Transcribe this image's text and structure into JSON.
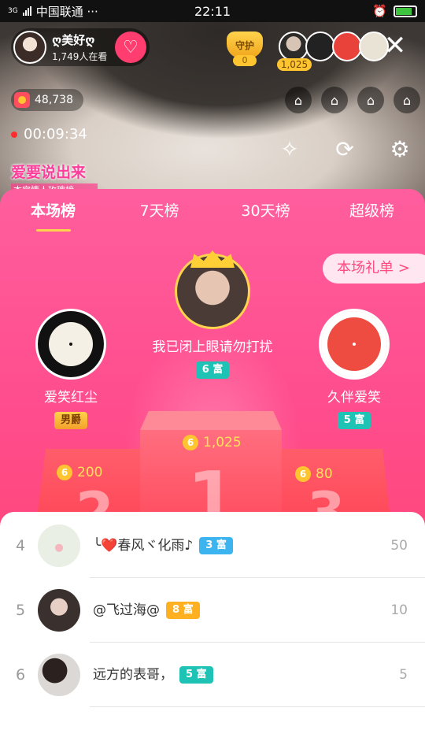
{
  "statusbar": {
    "network": "3G",
    "carrier": "中国联通 ···",
    "time": "22:11"
  },
  "host": {
    "name": "ღ美好ღ",
    "viewers": "1,749人在看"
  },
  "guard": {
    "label": "守护",
    "count": "0"
  },
  "top_viewer_badge": "1,025",
  "coins": {
    "value": "48,738"
  },
  "timer": "00:09:34",
  "banner": {
    "title": "爱要说出来",
    "subtitle": "本宫情人玫瑰榜"
  },
  "tabs": [
    {
      "label": "本场榜",
      "active": true
    },
    {
      "label": "7天榜",
      "active": false
    },
    {
      "label": "30天榜",
      "active": false
    },
    {
      "label": "超级榜",
      "active": false
    }
  ],
  "gift_list_button": "本场礼单 >",
  "podium": {
    "first": {
      "name": "我已闭上眼请勿打扰",
      "badge": "6 富",
      "score": "1,025"
    },
    "second": {
      "name": "爱笑红尘",
      "badge": "男爵",
      "score": "200",
      "place": "2"
    },
    "third": {
      "name": "久伴爱笑",
      "badge": "5 富",
      "score": "80",
      "place": "3"
    },
    "first_place": "1"
  },
  "list": [
    {
      "rank": "4",
      "name": "╰❤️春风ヾ化雨♪",
      "badge": "3 富",
      "value": "50"
    },
    {
      "rank": "5",
      "name": "@飞过海@",
      "badge": "8 富",
      "value": "10"
    },
    {
      "rank": "6",
      "name": "远方的表哥，",
      "badge": "5 富",
      "value": "5"
    }
  ],
  "colors": {
    "panel_top": "#ff5e9e",
    "panel_bottom": "#ff4b6f",
    "accent_gold": "#ffd34d",
    "badge_teal": "#1fc3b5",
    "badge_blue": "#3cb4f0",
    "badge_orange": "#ffb020"
  },
  "icons": [
    "heart-plus-icon",
    "close-icon",
    "coin-icon",
    "seat-icon",
    "magic-wand-icon",
    "camera-switch-icon",
    "gear-icon",
    "crown-icon",
    "chevron-right-icon"
  ]
}
